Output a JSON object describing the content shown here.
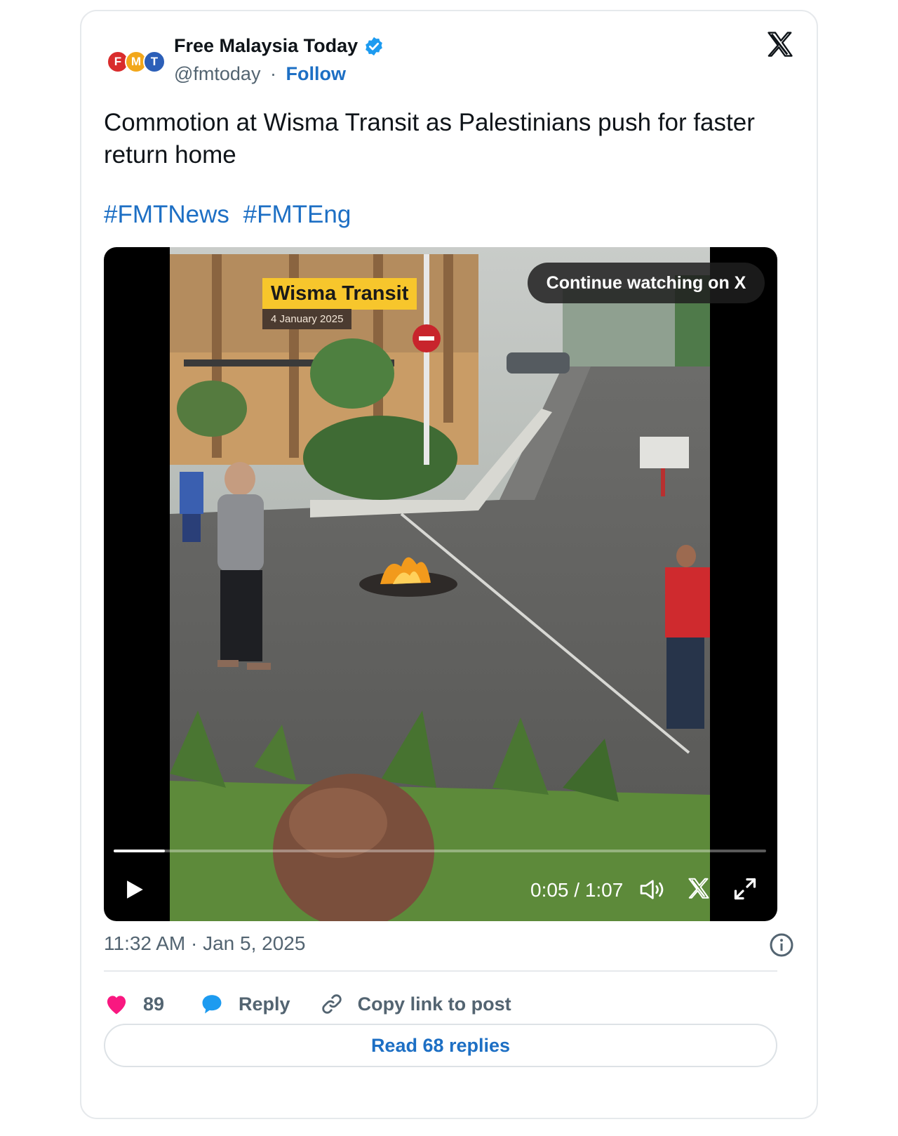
{
  "author": {
    "logo_letters": [
      "F",
      "M",
      "T"
    ],
    "logo_colors": [
      "#d92c2c",
      "#f2a71b",
      "#2c5fb8"
    ],
    "name": "Free Malaysia Today",
    "handle": "@fmtoday",
    "separator": "·",
    "follow_label": "Follow",
    "verified_color": "#1d9bf0"
  },
  "tweet": {
    "text": "Commotion at Wisma Transit as Palestinians push for faster return home",
    "hashtags": [
      "#FMTNews",
      "#FMTEng"
    ]
  },
  "video": {
    "overlay_title": "Wisma Transit",
    "overlay_date": "4 January 2025",
    "continue_label": "Continue watching on X",
    "time": "0:05 / 1:07",
    "progress": 0.078
  },
  "meta": {
    "timestamp": "11:32 AM · Jan 5, 2025"
  },
  "actions": {
    "like_count": "89",
    "reply_label": "Reply",
    "copy_label": "Copy link to post",
    "like_color": "#f91880",
    "reply_color": "#1d9bf0"
  },
  "read_replies_label": "Read 68 replies"
}
